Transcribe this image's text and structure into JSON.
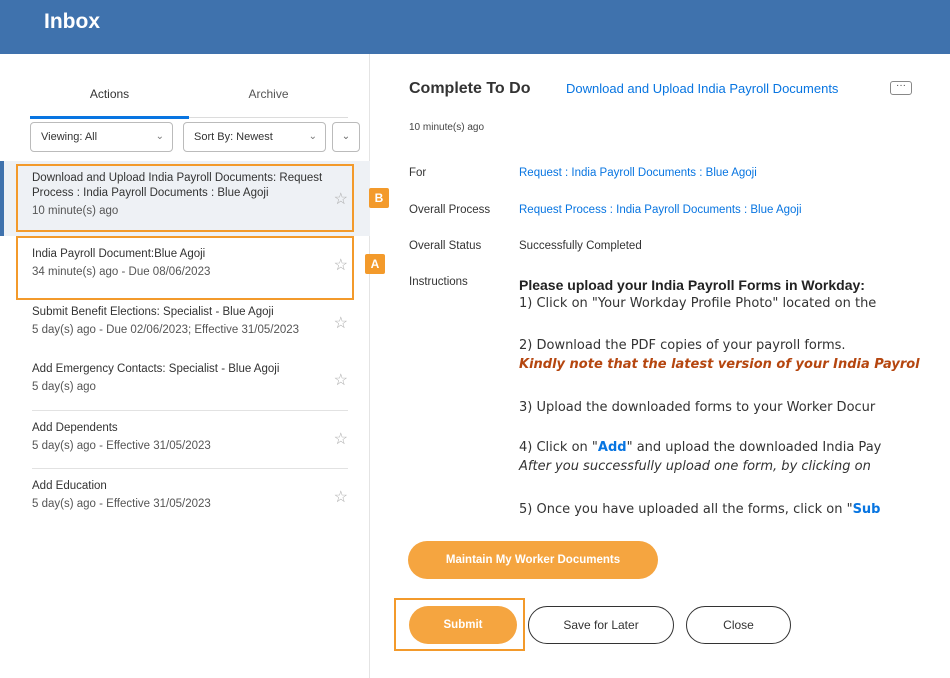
{
  "header": {
    "title": "Inbox"
  },
  "left": {
    "tabs": [
      {
        "label": "Actions"
      },
      {
        "label": "Archive"
      }
    ],
    "filters": {
      "viewing": "Viewing: All",
      "sort": "Sort By: Newest"
    },
    "items": [
      {
        "title_line1": "Download and Upload India Payroll Documents: Request",
        "title_line2": "Process : India Payroll Documents : Blue Agoji",
        "sub": "10 minute(s) ago"
      },
      {
        "title_line1": "India Payroll Document:Blue Agoji",
        "sub": "34 minute(s) ago - Due 08/06/2023"
      },
      {
        "title_line1": "Submit Benefit Elections: Specialist - Blue Agoji",
        "sub": "5 day(s) ago - Due 02/06/2023; Effective 31/05/2023"
      },
      {
        "title_line1": "Add Emergency Contacts: Specialist - Blue Agoji",
        "sub": "5 day(s) ago"
      },
      {
        "title_line1": "Add Dependents",
        "sub": "5 day(s) ago - Effective 31/05/2023"
      },
      {
        "title_line1": "Add Education",
        "sub": "5 day(s) ago - Effective 31/05/2023"
      }
    ],
    "callouts": {
      "a": "A",
      "b": "B"
    }
  },
  "detail": {
    "title": "Complete To Do",
    "link": "Download and Upload India Payroll Documents",
    "more": "···",
    "ago": "10 minute(s) ago",
    "fields": {
      "for_label": "For",
      "for_value": "Request : India Payroll Documents : Blue Agoji",
      "process_label": "Overall Process",
      "process_value": "Request Process : India Payroll Documents : Blue Agoji",
      "status_label": "Overall Status",
      "status_value": "Successfully Completed",
      "instructions_label": "Instructions"
    },
    "instructions": {
      "heading": "Please upload your India Payroll Forms in Workday:",
      "step1": "1) Click on \"Your Workday Profile Photo\" located on the",
      "step2": "2) Download the PDF copies of your payroll forms.",
      "step2_note": "Kindly note that the latest version of your India Payrol",
      "step3": "3) Upload the downloaded forms to your Worker Docur",
      "step4_pre": "4) Click on \"",
      "step4_add": "Add",
      "step4_post": "\" and upload the downloaded India Pay",
      "step4_note": "After you successfully upload one form, by clicking on",
      "step5_pre": "5) Once you have uploaded all the forms, click on \"",
      "step5_bold": "Sub"
    },
    "buttons": {
      "maintain": "Maintain My Worker Documents",
      "submit": "Submit",
      "save": "Save for Later",
      "close": "Close"
    }
  },
  "colors": {
    "header_bg": "#3f72ad",
    "accent_blue": "#0875e1",
    "callout_orange": "#f39a2b",
    "button_orange": "#f5a540"
  }
}
